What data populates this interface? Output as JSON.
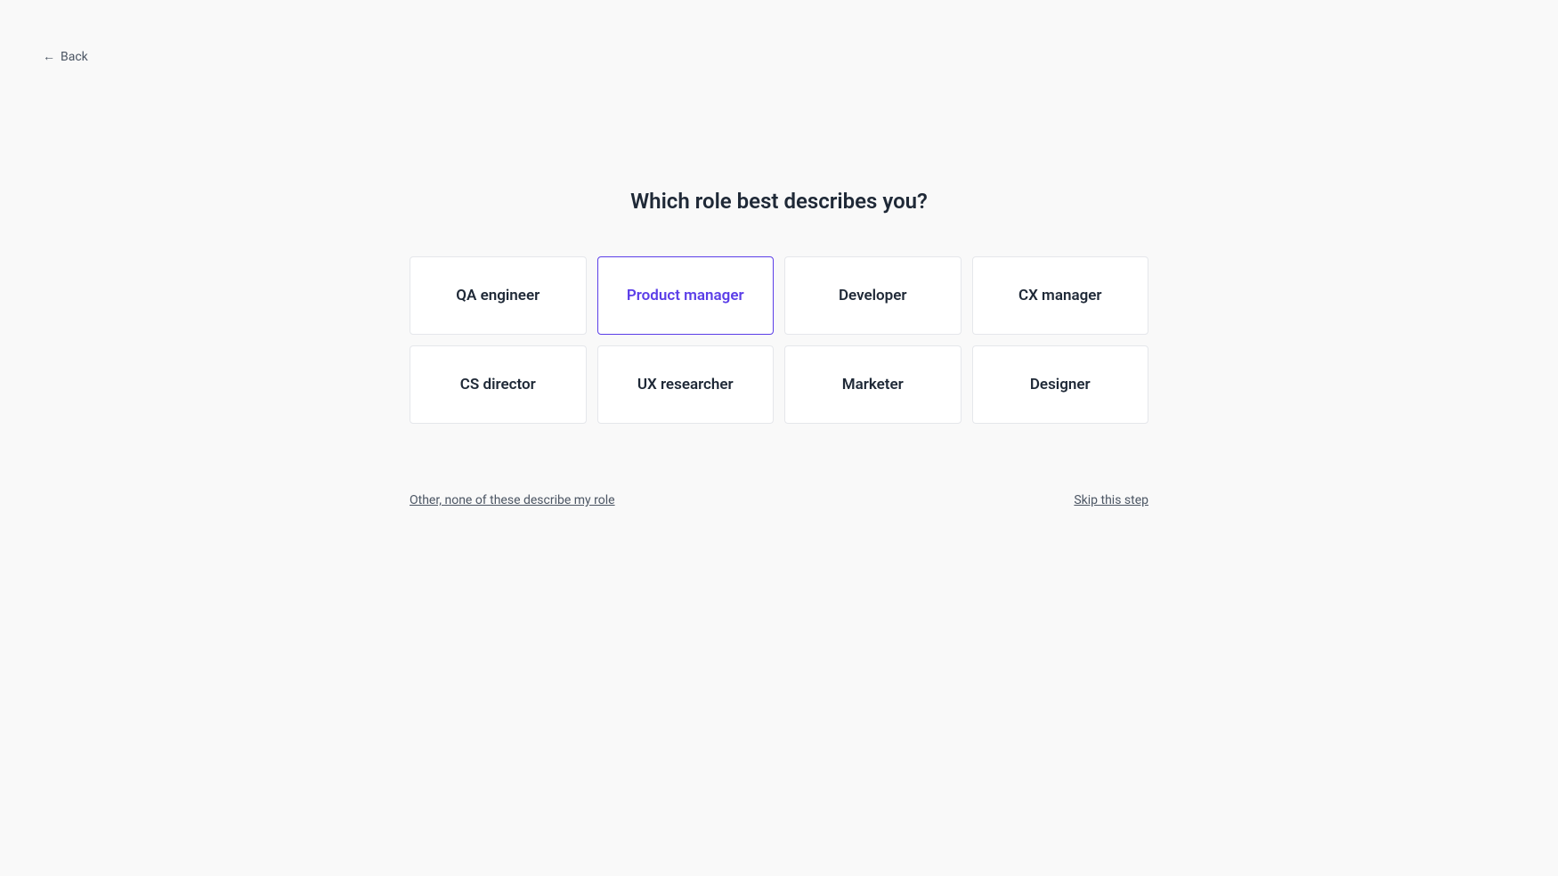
{
  "back": {
    "label": "Back",
    "arrow": "←"
  },
  "heading": "Which role best describes you?",
  "roles": [
    {
      "label": "QA engineer",
      "selected": false
    },
    {
      "label": "Product manager",
      "selected": true
    },
    {
      "label": "Developer",
      "selected": false
    },
    {
      "label": "CX manager",
      "selected": false
    },
    {
      "label": "CS director",
      "selected": false
    },
    {
      "label": "UX researcher",
      "selected": false
    },
    {
      "label": "Marketer",
      "selected": false
    },
    {
      "label": "Designer",
      "selected": false
    }
  ],
  "footer": {
    "other_label": "Other, none of these describe my role",
    "skip_label": "Skip this step"
  }
}
